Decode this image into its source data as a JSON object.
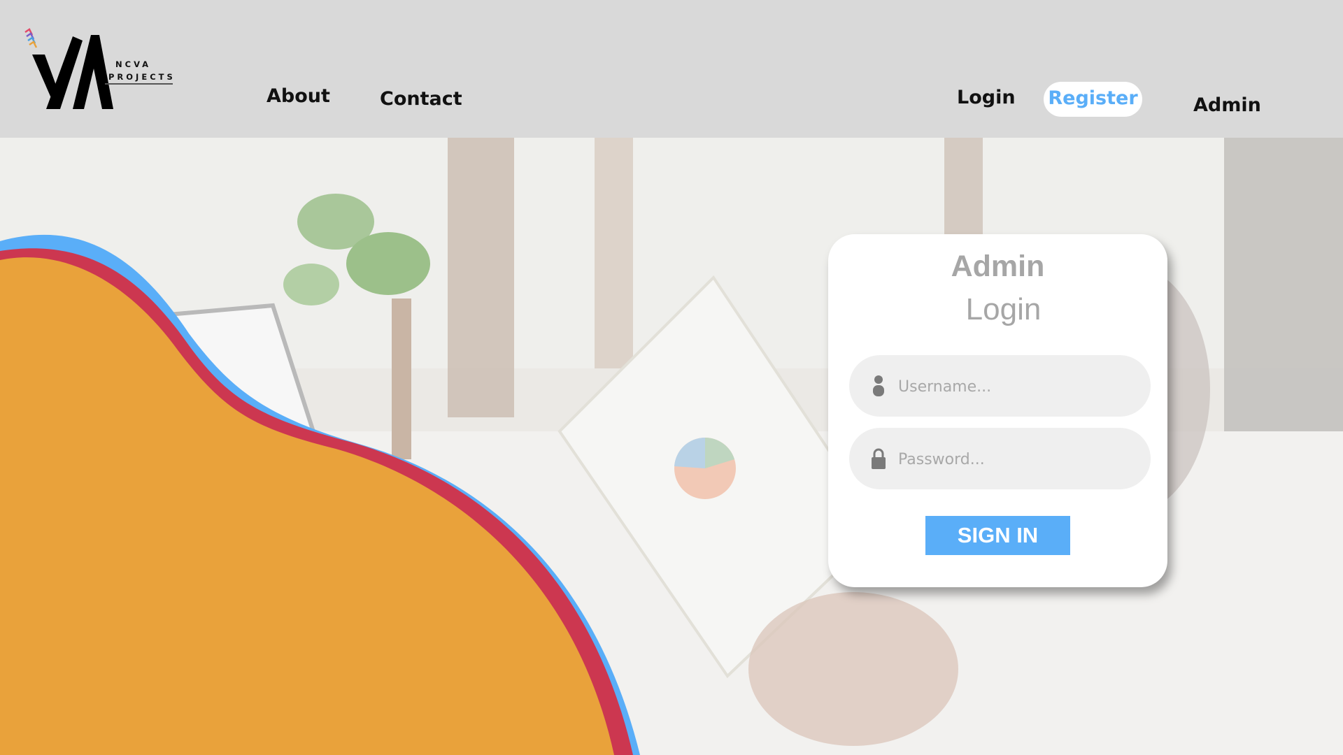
{
  "brand": {
    "logo_line1": "NCVA",
    "logo_line2": "PROJECTS"
  },
  "nav": {
    "about": "About",
    "contact": "Contact",
    "login": "Login",
    "register": "Register",
    "admin": "Admin"
  },
  "login_card": {
    "title": "Admin",
    "subtitle": "Login",
    "username_placeholder": "Username...",
    "password_placeholder": "Password...",
    "signin_label": "SIGN IN",
    "username_icon": "user-icon",
    "password_icon": "lock-icon"
  },
  "colors": {
    "header_bg": "#d9d9d9",
    "accent_blue": "#5aaef8",
    "wave_orange": "#e9a23b",
    "wave_red": "#cc3750",
    "card_text": "#a6a6a6"
  }
}
